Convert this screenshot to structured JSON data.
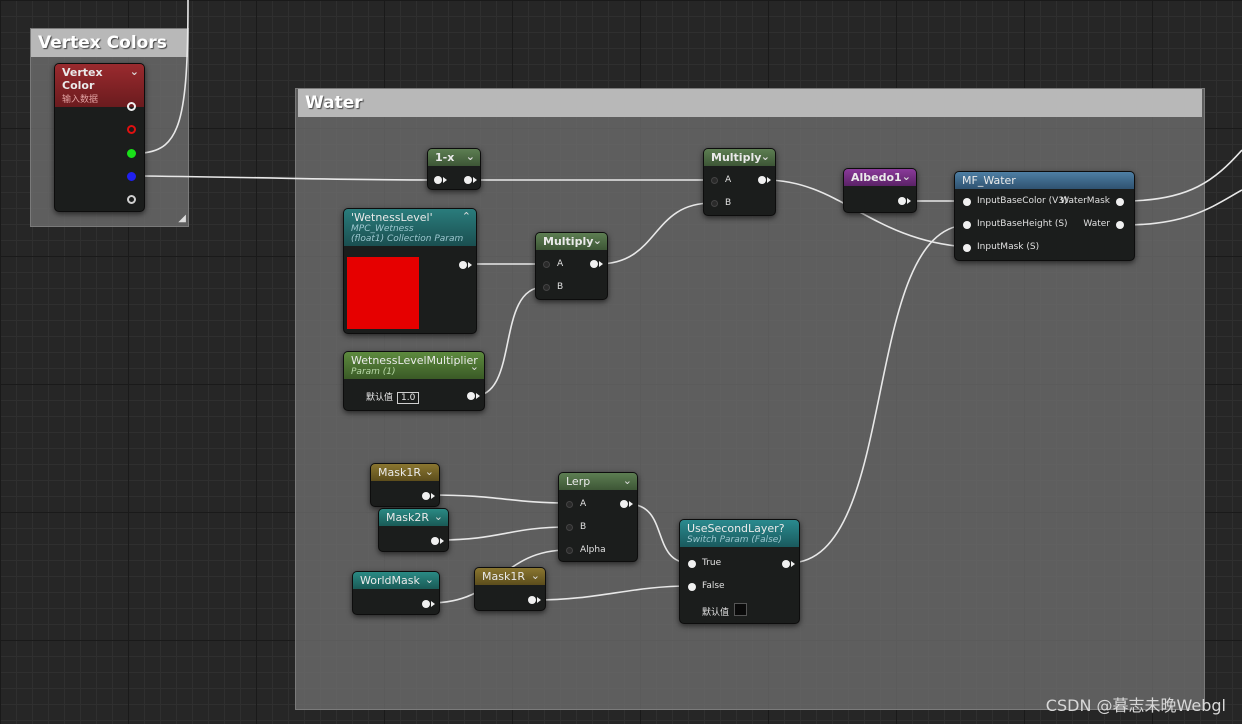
{
  "comments": {
    "vertex_colors": "Vertex Colors",
    "water": "Water"
  },
  "nodes": {
    "vertex_color": {
      "title": "Vertex Color",
      "subtitle": "输入数据"
    },
    "one_minus_x": {
      "title": "1-x"
    },
    "multiply_top": {
      "title": "Multiply",
      "pin_a": "A",
      "pin_b": "B"
    },
    "multiply_mid": {
      "title": "Multiply",
      "pin_a": "A",
      "pin_b": "B"
    },
    "albedo1": {
      "title": "Albedo1"
    },
    "mf_water": {
      "title": "MF_Water",
      "inputs": [
        "InputBaseColor (V3)",
        "InputBaseHeight (S)",
        "InputMask (S)"
      ],
      "outputs": [
        "WaterMask",
        "Water"
      ]
    },
    "wetness_level": {
      "title": "'WetnessLevel'",
      "subtitle1": "MPC_Wetness",
      "subtitle2": "(float1) Collection Param",
      "preview_color": "#e60000"
    },
    "wetness_multiplier": {
      "title": "WetnessLevelMultiplier",
      "subtitle": "Param (1)",
      "default_label": "默认值",
      "default_value": "1.0"
    },
    "mask1r_top": {
      "title": "Mask1R"
    },
    "mask2r": {
      "title": "Mask2R"
    },
    "world_mask": {
      "title": "WorldMask"
    },
    "mask1r_bottom": {
      "title": "Mask1R"
    },
    "lerp": {
      "title": "Lerp",
      "pin_a": "A",
      "pin_b": "B",
      "pin_alpha": "Alpha"
    },
    "use_second_layer": {
      "title": "UseSecondLayer?",
      "subtitle": "Switch Param (False)",
      "pin_true": "True",
      "pin_false": "False",
      "default_label": "默认值"
    }
  },
  "colors": {
    "vertex_header": "#7a1f22",
    "green_header": "#4f6e45",
    "teal_header": "#1f6b6b",
    "olive_header": "#6f6026",
    "purple_header": "#6b2c7a",
    "blue_header": "#3d6a8a",
    "pin_red": "#e01010",
    "pin_green": "#19e019",
    "pin_blue": "#2020f0"
  },
  "watermark": "CSDN @暮志未晚Webgl"
}
